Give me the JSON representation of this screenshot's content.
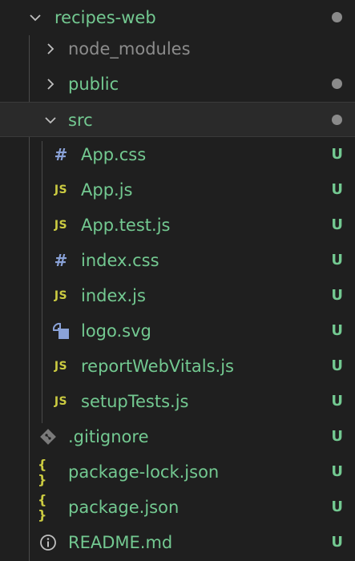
{
  "explorer": {
    "root": {
      "label": "recipes-web",
      "icon": "chevron-down-icon"
    },
    "items": [
      {
        "label": "node_modules",
        "icon": "chevron-right-icon",
        "badge": ""
      },
      {
        "label": "public",
        "icon": "chevron-right-icon",
        "badge": ""
      },
      {
        "label": "src",
        "icon": "chevron-down-icon",
        "badge": ""
      },
      {
        "label": "App.css",
        "icon": "css-hash-icon",
        "badge": "U"
      },
      {
        "label": "App.js",
        "icon": "js-file-icon",
        "badge": "U"
      },
      {
        "label": "App.test.js",
        "icon": "js-file-icon",
        "badge": "U"
      },
      {
        "label": "index.css",
        "icon": "css-hash-icon",
        "badge": "U"
      },
      {
        "label": "index.js",
        "icon": "js-file-icon",
        "badge": "U"
      },
      {
        "label": "logo.svg",
        "icon": "svg-image-icon",
        "badge": "U"
      },
      {
        "label": "reportWebVitals.js",
        "icon": "js-file-icon",
        "badge": "U"
      },
      {
        "label": "setupTests.js",
        "icon": "js-file-icon",
        "badge": "U"
      },
      {
        "label": ".gitignore",
        "icon": "git-icon",
        "badge": "U"
      },
      {
        "label": "package-lock.json",
        "icon": "json-braces-icon",
        "badge": "U"
      },
      {
        "label": "package.json",
        "icon": "json-braces-icon",
        "badge": "U"
      },
      {
        "label": "README.md",
        "icon": "info-icon",
        "badge": "U"
      }
    ],
    "icon_text": {
      "hash": "#",
      "js": "JS",
      "braces": "{ }"
    },
    "colors": {
      "background": "#1f1f1f",
      "untracked_text": "#73c991",
      "ignored_text": "#8c8c8c",
      "js_icon": "#cbcb41",
      "css_icon": "#8aa2d8",
      "modified_dot": "#8a8a8a"
    }
  }
}
